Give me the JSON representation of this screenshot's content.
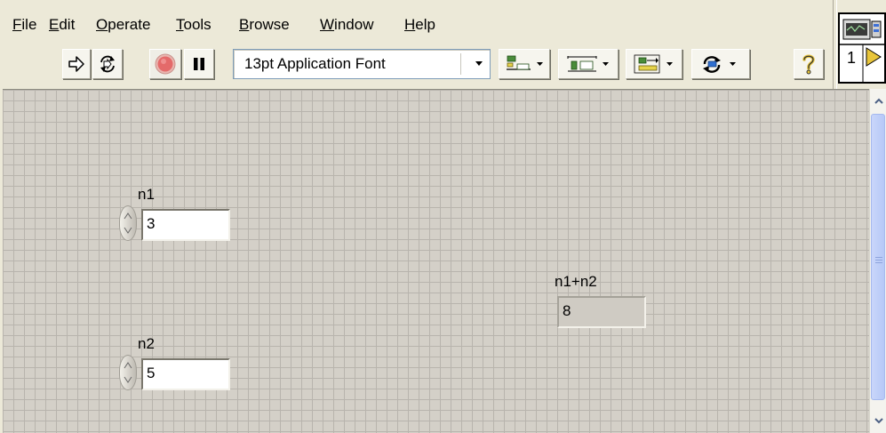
{
  "menu": [
    {
      "key": "file",
      "accel": "F",
      "rest": "ile"
    },
    {
      "key": "edit",
      "accel": "E",
      "rest": "dit"
    },
    {
      "key": "operate",
      "accel": "O",
      "rest": "perate"
    },
    {
      "key": "tools",
      "accel": "T",
      "rest": "ools"
    },
    {
      "key": "browse",
      "accel": "B",
      "rest": "rowse"
    },
    {
      "key": "window",
      "accel": "W",
      "rest": "indow"
    },
    {
      "key": "help",
      "accel": "H",
      "rest": "elp"
    }
  ],
  "toolbar": {
    "font_select_value": "13pt Application Font",
    "run_icon": "run-arrow-icon",
    "run_continuous_icon": "run-continuously-icon",
    "abort_icon": "abort-stop-icon",
    "pause_icon": "pause-icon",
    "align_icon": "align-objects-icon",
    "distribute_icon": "distribute-objects-icon",
    "resize_icon": "resize-objects-icon",
    "reorder_icon": "reorder-icon",
    "help_icon": "context-help-icon"
  },
  "vi_icon": {
    "terminal_number": "1"
  },
  "panel": {
    "controls": [
      {
        "label": "n1",
        "value": "3",
        "kind": "control"
      },
      {
        "label": "n2",
        "value": "5",
        "kind": "control"
      }
    ],
    "indicator": {
      "label": "n1+n2",
      "value": "8",
      "kind": "indicator"
    }
  },
  "colors": {
    "window_bg": "#ece9d8",
    "panel_bg": "#d4d0c8",
    "grid_line": "#b8b4ad",
    "abort_red": "#e46a6a",
    "scroll_thumb": "#c1d3fb"
  }
}
